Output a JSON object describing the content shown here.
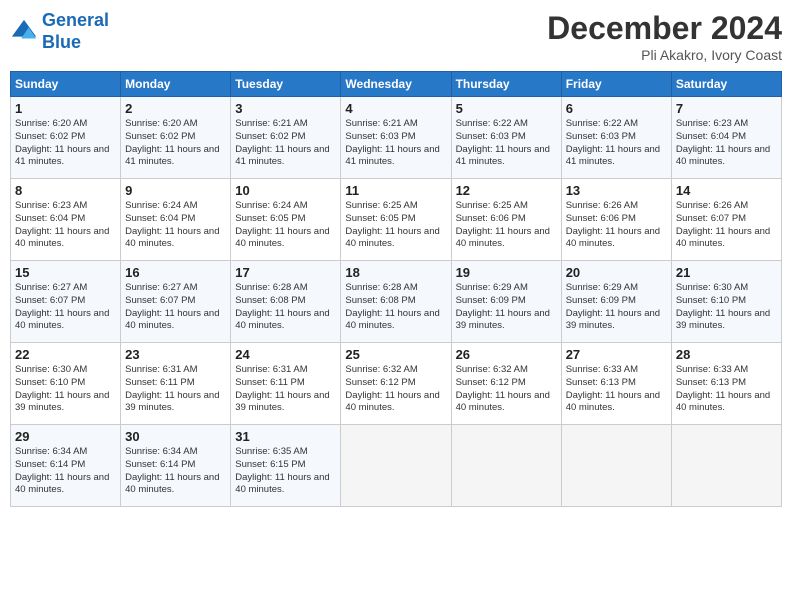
{
  "header": {
    "logo_line1": "General",
    "logo_line2": "Blue",
    "month": "December 2024",
    "location": "Pli Akakro, Ivory Coast"
  },
  "days_of_week": [
    "Sunday",
    "Monday",
    "Tuesday",
    "Wednesday",
    "Thursday",
    "Friday",
    "Saturday"
  ],
  "weeks": [
    [
      {
        "day": "1",
        "sunrise": "6:20 AM",
        "sunset": "6:02 PM",
        "daylight": "11 hours and 41 minutes."
      },
      {
        "day": "2",
        "sunrise": "6:20 AM",
        "sunset": "6:02 PM",
        "daylight": "11 hours and 41 minutes."
      },
      {
        "day": "3",
        "sunrise": "6:21 AM",
        "sunset": "6:02 PM",
        "daylight": "11 hours and 41 minutes."
      },
      {
        "day": "4",
        "sunrise": "6:21 AM",
        "sunset": "6:03 PM",
        "daylight": "11 hours and 41 minutes."
      },
      {
        "day": "5",
        "sunrise": "6:22 AM",
        "sunset": "6:03 PM",
        "daylight": "11 hours and 41 minutes."
      },
      {
        "day": "6",
        "sunrise": "6:22 AM",
        "sunset": "6:03 PM",
        "daylight": "11 hours and 41 minutes."
      },
      {
        "day": "7",
        "sunrise": "6:23 AM",
        "sunset": "6:04 PM",
        "daylight": "11 hours and 40 minutes."
      }
    ],
    [
      {
        "day": "8",
        "sunrise": "6:23 AM",
        "sunset": "6:04 PM",
        "daylight": "11 hours and 40 minutes."
      },
      {
        "day": "9",
        "sunrise": "6:24 AM",
        "sunset": "6:04 PM",
        "daylight": "11 hours and 40 minutes."
      },
      {
        "day": "10",
        "sunrise": "6:24 AM",
        "sunset": "6:05 PM",
        "daylight": "11 hours and 40 minutes."
      },
      {
        "day": "11",
        "sunrise": "6:25 AM",
        "sunset": "6:05 PM",
        "daylight": "11 hours and 40 minutes."
      },
      {
        "day": "12",
        "sunrise": "6:25 AM",
        "sunset": "6:06 PM",
        "daylight": "11 hours and 40 minutes."
      },
      {
        "day": "13",
        "sunrise": "6:26 AM",
        "sunset": "6:06 PM",
        "daylight": "11 hours and 40 minutes."
      },
      {
        "day": "14",
        "sunrise": "6:26 AM",
        "sunset": "6:07 PM",
        "daylight": "11 hours and 40 minutes."
      }
    ],
    [
      {
        "day": "15",
        "sunrise": "6:27 AM",
        "sunset": "6:07 PM",
        "daylight": "11 hours and 40 minutes."
      },
      {
        "day": "16",
        "sunrise": "6:27 AM",
        "sunset": "6:07 PM",
        "daylight": "11 hours and 40 minutes."
      },
      {
        "day": "17",
        "sunrise": "6:28 AM",
        "sunset": "6:08 PM",
        "daylight": "11 hours and 40 minutes."
      },
      {
        "day": "18",
        "sunrise": "6:28 AM",
        "sunset": "6:08 PM",
        "daylight": "11 hours and 40 minutes."
      },
      {
        "day": "19",
        "sunrise": "6:29 AM",
        "sunset": "6:09 PM",
        "daylight": "11 hours and 39 minutes."
      },
      {
        "day": "20",
        "sunrise": "6:29 AM",
        "sunset": "6:09 PM",
        "daylight": "11 hours and 39 minutes."
      },
      {
        "day": "21",
        "sunrise": "6:30 AM",
        "sunset": "6:10 PM",
        "daylight": "11 hours and 39 minutes."
      }
    ],
    [
      {
        "day": "22",
        "sunrise": "6:30 AM",
        "sunset": "6:10 PM",
        "daylight": "11 hours and 39 minutes."
      },
      {
        "day": "23",
        "sunrise": "6:31 AM",
        "sunset": "6:11 PM",
        "daylight": "11 hours and 39 minutes."
      },
      {
        "day": "24",
        "sunrise": "6:31 AM",
        "sunset": "6:11 PM",
        "daylight": "11 hours and 39 minutes."
      },
      {
        "day": "25",
        "sunrise": "6:32 AM",
        "sunset": "6:12 PM",
        "daylight": "11 hours and 40 minutes."
      },
      {
        "day": "26",
        "sunrise": "6:32 AM",
        "sunset": "6:12 PM",
        "daylight": "11 hours and 40 minutes."
      },
      {
        "day": "27",
        "sunrise": "6:33 AM",
        "sunset": "6:13 PM",
        "daylight": "11 hours and 40 minutes."
      },
      {
        "day": "28",
        "sunrise": "6:33 AM",
        "sunset": "6:13 PM",
        "daylight": "11 hours and 40 minutes."
      }
    ],
    [
      {
        "day": "29",
        "sunrise": "6:34 AM",
        "sunset": "6:14 PM",
        "daylight": "11 hours and 40 minutes."
      },
      {
        "day": "30",
        "sunrise": "6:34 AM",
        "sunset": "6:14 PM",
        "daylight": "11 hours and 40 minutes."
      },
      {
        "day": "31",
        "sunrise": "6:35 AM",
        "sunset": "6:15 PM",
        "daylight": "11 hours and 40 minutes."
      },
      null,
      null,
      null,
      null
    ]
  ]
}
